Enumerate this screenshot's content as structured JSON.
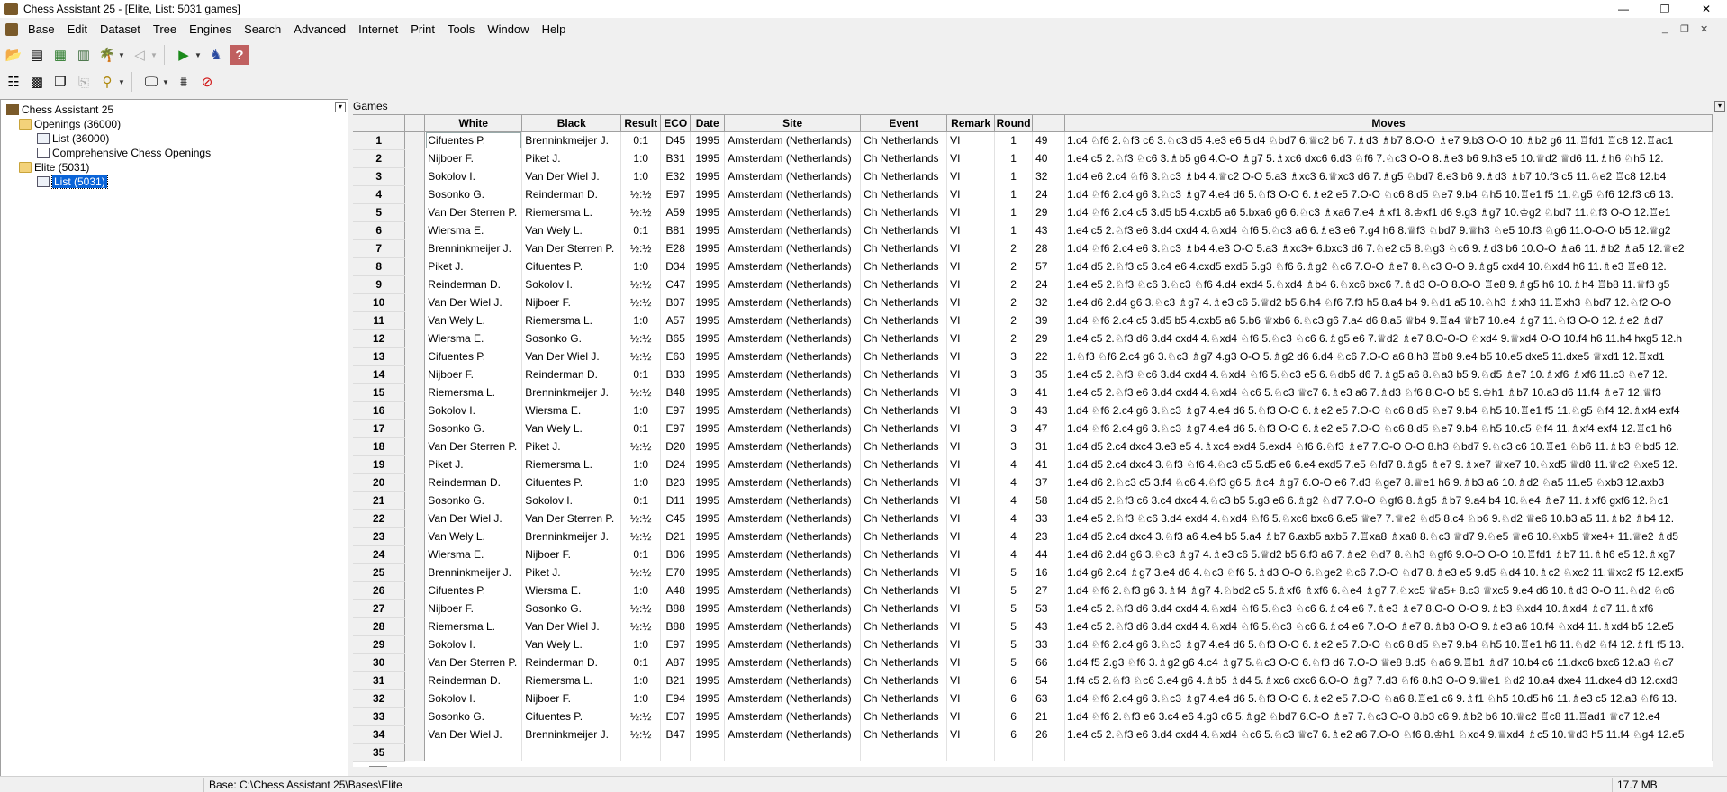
{
  "window": {
    "title": "Chess Assistant 25 - [Elite, List: 5031 games]",
    "controls": {
      "minimize": "—",
      "maximize": "❐",
      "close": "✕"
    },
    "mdi_controls": {
      "minimize": "_",
      "restore": "❐",
      "close": "✕"
    }
  },
  "menu": [
    "Base",
    "Edit",
    "Dataset",
    "Tree",
    "Engines",
    "Search",
    "Advanced",
    "Internet",
    "Print",
    "Tools",
    "Window",
    "Help"
  ],
  "toolbar1": [
    {
      "name": "open-icon",
      "glyph": "📂"
    },
    {
      "name": "list-view-icon",
      "glyph": "▤"
    },
    {
      "name": "database-icon",
      "glyph": "▦"
    },
    {
      "name": "table-icon",
      "glyph": "▥"
    },
    {
      "name": "tree-icon",
      "glyph": "🌴"
    },
    {
      "name": "back-icon",
      "glyph": "◁"
    },
    {
      "name": "play-icon",
      "glyph": "▶"
    },
    {
      "name": "engine-icon",
      "glyph": "♞"
    },
    {
      "name": "help-icon",
      "glyph": "?"
    }
  ],
  "toolbar2": [
    {
      "name": "tree-list-icon",
      "glyph": "☷"
    },
    {
      "name": "board-icon",
      "glyph": "▩"
    },
    {
      "name": "copy-icon",
      "glyph": "❐"
    },
    {
      "name": "paste-icon",
      "glyph": "⎘"
    },
    {
      "name": "find-icon",
      "glyph": "⚲"
    },
    {
      "name": "monitor-icon",
      "glyph": "🖵"
    },
    {
      "name": "filter-icon",
      "glyph": "⩩"
    },
    {
      "name": "stop-icon",
      "glyph": "⊘"
    }
  ],
  "tree": {
    "root": "Chess Assistant 25",
    "openings": "Openings (36000)",
    "openings_list": "List (36000)",
    "comprehensive": "Comprehensive Chess Openings",
    "elite": "Elite (5031)",
    "elite_list": "List (5031)"
  },
  "games_label": "Games",
  "columns": [
    "White",
    "Black",
    "Result",
    "ECO",
    "Date",
    "Site",
    "Event",
    "Remark",
    "Round",
    "",
    "Moves"
  ],
  "rows": [
    [
      "1",
      "Cifuentes P.",
      "Brenninkmeijer J.",
      "0:1",
      "D45",
      "1995",
      "Amsterdam (Netherlands)",
      "Ch Netherlands",
      "VI",
      "1",
      "49",
      "1.c4 ♘f6 2.♘f3 c6 3.♘c3 d5 4.e3 e6 5.d4 ♘bd7 6.♕c2 b6 7.♗d3 ♗b7 8.O-O ♗e7 9.b3 O-O 10.♗b2 g6 11.♖fd1 ♖c8 12.♖ac1"
    ],
    [
      "2",
      "Nijboer F.",
      "Piket J.",
      "1:0",
      "B31",
      "1995",
      "Amsterdam (Netherlands)",
      "Ch Netherlands",
      "VI",
      "1",
      "40",
      "1.e4 c5 2.♘f3 ♘c6 3.♗b5 g6 4.O-O ♗g7 5.♗xc6 dxc6 6.d3 ♘f6 7.♘c3 O-O 8.♗e3 b6 9.h3 e5 10.♕d2 ♕d6 11.♗h6 ♘h5 12."
    ],
    [
      "3",
      "Sokolov I.",
      "Van Der Wiel J.",
      "1:0",
      "E32",
      "1995",
      "Amsterdam (Netherlands)",
      "Ch Netherlands",
      "VI",
      "1",
      "32",
      "1.d4 e6 2.c4 ♘f6 3.♘c3 ♗b4 4.♕c2 O-O 5.a3 ♗xc3 6.♕xc3 d6 7.♗g5 ♘bd7 8.e3 b6 9.♗d3 ♗b7 10.f3 c5 11.♘e2 ♖c8 12.b4"
    ],
    [
      "4",
      "Sosonko G.",
      "Reinderman D.",
      "½:½",
      "E97",
      "1995",
      "Amsterdam (Netherlands)",
      "Ch Netherlands",
      "VI",
      "1",
      "24",
      "1.d4 ♘f6 2.c4 g6 3.♘c3 ♗g7 4.e4 d6 5.♘f3 O-O 6.♗e2 e5 7.O-O ♘c6 8.d5 ♘e7 9.b4 ♘h5 10.♖e1 f5 11.♘g5 ♘f6 12.f3 c6 13."
    ],
    [
      "5",
      "Van Der Sterren P.",
      "Riemersma L.",
      "½:½",
      "A59",
      "1995",
      "Amsterdam (Netherlands)",
      "Ch Netherlands",
      "VI",
      "1",
      "29",
      "1.d4 ♘f6 2.c4 c5 3.d5 b5 4.cxb5 a6 5.bxa6 g6 6.♘c3 ♗xa6 7.e4 ♗xf1 8.♔xf1 d6 9.g3 ♗g7 10.♔g2 ♘bd7 11.♘f3 O-O 12.♖e1"
    ],
    [
      "6",
      "Wiersma E.",
      "Van Wely L.",
      "0:1",
      "B81",
      "1995",
      "Amsterdam (Netherlands)",
      "Ch Netherlands",
      "VI",
      "1",
      "43",
      "1.e4 c5 2.♘f3 e6 3.d4 cxd4 4.♘xd4 ♘f6 5.♘c3 a6 6.♗e3 e6 7.g4 h6 8.♕f3 ♘bd7 9.♕h3 ♘e5 10.f3 ♘g6 11.O-O-O b5 12.♕g2"
    ],
    [
      "7",
      "Brenninkmeijer J.",
      "Van Der Sterren P.",
      "½:½",
      "E28",
      "1995",
      "Amsterdam (Netherlands)",
      "Ch Netherlands",
      "VI",
      "2",
      "28",
      "1.d4 ♘f6 2.c4 e6 3.♘c3 ♗b4 4.e3 O-O 5.a3 ♗xc3+ 6.bxc3 d6 7.♘e2 c5 8.♘g3 ♘c6 9.♗d3 b6 10.O-O ♗a6 11.♗b2 ♗a5 12.♕e2"
    ],
    [
      "8",
      "Piket J.",
      "Cifuentes P.",
      "1:0",
      "D34",
      "1995",
      "Amsterdam (Netherlands)",
      "Ch Netherlands",
      "VI",
      "2",
      "57",
      "1.d4 d5 2.♘f3 c5 3.c4 e6 4.cxd5 exd5 5.g3 ♘f6 6.♗g2 ♘c6 7.O-O ♗e7 8.♘c3 O-O 9.♗g5 cxd4 10.♘xd4 h6 11.♗e3 ♖e8 12."
    ],
    [
      "9",
      "Reinderman D.",
      "Sokolov I.",
      "½:½",
      "C47",
      "1995",
      "Amsterdam (Netherlands)",
      "Ch Netherlands",
      "VI",
      "2",
      "24",
      "1.e4 e5 2.♘f3 ♘c6 3.♘c3 ♘f6 4.d4 exd4 5.♘xd4 ♗b4 6.♘xc6 bxc6 7.♗d3 O-O 8.O-O ♖e8 9.♗g5 h6 10.♗h4 ♖b8 11.♕f3 g5"
    ],
    [
      "10",
      "Van Der Wiel J.",
      "Nijboer F.",
      "½:½",
      "B07",
      "1995",
      "Amsterdam (Netherlands)",
      "Ch Netherlands",
      "VI",
      "2",
      "32",
      "1.e4 d6 2.d4 g6 3.♘c3 ♗g7 4.♗e3 c6 5.♕d2 b5 6.h4 ♘f6 7.f3 h5 8.a4 b4 9.♘d1 a5 10.♘h3 ♗xh3 11.♖xh3 ♘bd7 12.♘f2 O-O"
    ],
    [
      "11",
      "Van Wely L.",
      "Riemersma L.",
      "1:0",
      "A57",
      "1995",
      "Amsterdam (Netherlands)",
      "Ch Netherlands",
      "VI",
      "2",
      "39",
      "1.d4 ♘f6 2.c4 c5 3.d5 b5 4.cxb5 a6 5.b6 ♕xb6 6.♘c3 g6 7.a4 d6 8.a5 ♕b4 9.♖a4 ♕b7 10.e4 ♗g7 11.♘f3 O-O 12.♗e2 ♗d7"
    ],
    [
      "12",
      "Wiersma E.",
      "Sosonko G.",
      "½:½",
      "B65",
      "1995",
      "Amsterdam (Netherlands)",
      "Ch Netherlands",
      "VI",
      "2",
      "29",
      "1.e4 c5 2.♘f3 d6 3.d4 cxd4 4.♘xd4 ♘f6 5.♘c3 ♘c6 6.♗g5 e6 7.♕d2 ♗e7 8.O-O-O ♘xd4 9.♕xd4 O-O 10.f4 h6 11.h4 hxg5 12.h"
    ],
    [
      "13",
      "Cifuentes P.",
      "Van Der Wiel J.",
      "½:½",
      "E63",
      "1995",
      "Amsterdam (Netherlands)",
      "Ch Netherlands",
      "VI",
      "3",
      "22",
      "1.♘f3 ♘f6 2.c4 g6 3.♘c3 ♗g7 4.g3 O-O 5.♗g2 d6 6.d4 ♘c6 7.O-O a6 8.h3 ♖b8 9.e4 b5 10.e5 dxe5 11.dxe5 ♕xd1 12.♖xd1"
    ],
    [
      "14",
      "Nijboer F.",
      "Reinderman D.",
      "0:1",
      "B33",
      "1995",
      "Amsterdam (Netherlands)",
      "Ch Netherlands",
      "VI",
      "3",
      "35",
      "1.e4 c5 2.♘f3 ♘c6 3.d4 cxd4 4.♘xd4 ♘f6 5.♘c3 e5 6.♘db5 d6 7.♗g5 a6 8.♘a3 b5 9.♘d5 ♗e7 10.♗xf6 ♗xf6 11.c3 ♘e7 12."
    ],
    [
      "15",
      "Riemersma L.",
      "Brenninkmeijer J.",
      "½:½",
      "B48",
      "1995",
      "Amsterdam (Netherlands)",
      "Ch Netherlands",
      "VI",
      "3",
      "41",
      "1.e4 c5 2.♘f3 e6 3.d4 cxd4 4.♘xd4 ♘c6 5.♘c3 ♕c7 6.♗e3 a6 7.♗d3 ♘f6 8.O-O b5 9.♔h1 ♗b7 10.a3 d6 11.f4 ♗e7 12.♕f3"
    ],
    [
      "16",
      "Sokolov I.",
      "Wiersma E.",
      "1:0",
      "E97",
      "1995",
      "Amsterdam (Netherlands)",
      "Ch Netherlands",
      "VI",
      "3",
      "43",
      "1.d4 ♘f6 2.c4 g6 3.♘c3 ♗g7 4.e4 d6 5.♘f3 O-O 6.♗e2 e5 7.O-O ♘c6 8.d5 ♘e7 9.b4 ♘h5 10.♖e1 f5 11.♘g5 ♘f4 12.♗xf4 exf4"
    ],
    [
      "17",
      "Sosonko G.",
      "Van Wely L.",
      "0:1",
      "E97",
      "1995",
      "Amsterdam (Netherlands)",
      "Ch Netherlands",
      "VI",
      "3",
      "47",
      "1.d4 ♘f6 2.c4 g6 3.♘c3 ♗g7 4.e4 d6 5.♘f3 O-O 6.♗e2 e5 7.O-O ♘c6 8.d5 ♘e7 9.b4 ♘h5 10.c5 ♘f4 11.♗xf4 exf4 12.♖c1 h6"
    ],
    [
      "18",
      "Van Der Sterren P.",
      "Piket J.",
      "½:½",
      "D20",
      "1995",
      "Amsterdam (Netherlands)",
      "Ch Netherlands",
      "VI",
      "3",
      "31",
      "1.d4 d5 2.c4 dxc4 3.e3 e5 4.♗xc4 exd4 5.exd4 ♘f6 6.♘f3 ♗e7 7.O-O O-O 8.h3 ♘bd7 9.♘c3 c6 10.♖e1 ♘b6 11.♗b3 ♘bd5 12."
    ],
    [
      "19",
      "Piket J.",
      "Riemersma L.",
      "1:0",
      "D24",
      "1995",
      "Amsterdam (Netherlands)",
      "Ch Netherlands",
      "VI",
      "4",
      "41",
      "1.d4 d5 2.c4 dxc4 3.♘f3 ♘f6 4.♘c3 c5 5.d5 e6 6.e4 exd5 7.e5 ♘fd7 8.♗g5 ♗e7 9.♗xe7 ♕xe7 10.♘xd5 ♕d8 11.♕c2 ♘xe5 12."
    ],
    [
      "20",
      "Reinderman D.",
      "Cifuentes P.",
      "1:0",
      "B23",
      "1995",
      "Amsterdam (Netherlands)",
      "Ch Netherlands",
      "VI",
      "4",
      "37",
      "1.e4 d6 2.♘c3 c5 3.f4 ♘c6 4.♘f3 g6 5.♗c4 ♗g7 6.O-O e6 7.d3 ♘ge7 8.♕e1 h6 9.♗b3 a6 10.♗d2 ♘a5 11.e5 ♘xb3 12.axb3"
    ],
    [
      "21",
      "Sosonko G.",
      "Sokolov I.",
      "0:1",
      "D11",
      "1995",
      "Amsterdam (Netherlands)",
      "Ch Netherlands",
      "VI",
      "4",
      "58",
      "1.d4 d5 2.♘f3 c6 3.c4 dxc4 4.♘c3 b5 5.g3 e6 6.♗g2 ♘d7 7.O-O ♘gf6 8.♗g5 ♗b7 9.a4 b4 10.♘e4 ♗e7 11.♗xf6 gxf6 12.♘c1"
    ],
    [
      "22",
      "Van Der Wiel J.",
      "Van Der Sterren P.",
      "½:½",
      "C45",
      "1995",
      "Amsterdam (Netherlands)",
      "Ch Netherlands",
      "VI",
      "4",
      "33",
      "1.e4 e5 2.♘f3 ♘c6 3.d4 exd4 4.♘xd4 ♘f6 5.♘xc6 bxc6 6.e5 ♕e7 7.♕e2 ♘d5 8.c4 ♘b6 9.♘d2 ♕e6 10.b3 a5 11.♗b2 ♗b4 12."
    ],
    [
      "23",
      "Van Wely L.",
      "Brenninkmeijer J.",
      "½:½",
      "D21",
      "1995",
      "Amsterdam (Netherlands)",
      "Ch Netherlands",
      "VI",
      "4",
      "23",
      "1.d4 d5 2.c4 dxc4 3.♘f3 a6 4.e4 b5 5.a4 ♗b7 6.axb5 axb5 7.♖xa8 ♗xa8 8.♘c3 ♕d7 9.♘e5 ♕e6 10.♘xb5 ♕xe4+ 11.♕e2 ♗d5"
    ],
    [
      "24",
      "Wiersma E.",
      "Nijboer F.",
      "0:1",
      "B06",
      "1995",
      "Amsterdam (Netherlands)",
      "Ch Netherlands",
      "VI",
      "4",
      "44",
      "1.e4 d6 2.d4 g6 3.♘c3 ♗g7 4.♗e3 c6 5.♕d2 b5 6.f3 a6 7.♗e2 ♘d7 8.♘h3 ♘gf6 9.O-O O-O 10.♖fd1 ♗b7 11.♗h6 e5 12.♗xg7"
    ],
    [
      "25",
      "Brenninkmeijer J.",
      "Piket J.",
      "½:½",
      "E70",
      "1995",
      "Amsterdam (Netherlands)",
      "Ch Netherlands",
      "VI",
      "5",
      "16",
      "1.d4 g6 2.c4 ♗g7 3.e4 d6 4.♘c3 ♘f6 5.♗d3 O-O 6.♘ge2 ♘c6 7.O-O ♘d7 8.♗e3 e5 9.d5 ♘d4 10.♗c2 ♘xc2 11.♕xc2 f5 12.exf5"
    ],
    [
      "26",
      "Cifuentes P.",
      "Wiersma E.",
      "1:0",
      "A48",
      "1995",
      "Amsterdam (Netherlands)",
      "Ch Netherlands",
      "VI",
      "5",
      "27",
      "1.d4 ♘f6 2.♘f3 g6 3.♗f4 ♗g7 4.♘bd2 c5 5.♗xf6 ♗xf6 6.♘e4 ♗g7 7.♘xc5 ♕a5+ 8.c3 ♕xc5 9.e4 d6 10.♗d3 O-O 11.♘d2 ♘c6"
    ],
    [
      "27",
      "Nijboer F.",
      "Sosonko G.",
      "½:½",
      "B88",
      "1995",
      "Amsterdam (Netherlands)",
      "Ch Netherlands",
      "VI",
      "5",
      "53",
      "1.e4 c5 2.♘f3 d6 3.d4 cxd4 4.♘xd4 ♘f6 5.♘c3 ♘c6 6.♗c4 e6 7.♗e3 ♗e7 8.O-O O-O 9.♗b3 ♘xd4 10.♗xd4 ♗d7 11.♗xf6"
    ],
    [
      "28",
      "Riemersma L.",
      "Van Der Wiel J.",
      "½:½",
      "B88",
      "1995",
      "Amsterdam (Netherlands)",
      "Ch Netherlands",
      "VI",
      "5",
      "43",
      "1.e4 c5 2.♘f3 d6 3.d4 cxd4 4.♘xd4 ♘f6 5.♘c3 ♘c6 6.♗c4 e6 7.O-O ♗e7 8.♗b3 O-O 9.♗e3 a6 10.f4 ♘xd4 11.♗xd4 b5 12.e5"
    ],
    [
      "29",
      "Sokolov I.",
      "Van Wely L.",
      "1:0",
      "E97",
      "1995",
      "Amsterdam (Netherlands)",
      "Ch Netherlands",
      "VI",
      "5",
      "33",
      "1.d4 ♘f6 2.c4 g6 3.♘c3 ♗g7 4.e4 d6 5.♘f3 O-O 6.♗e2 e5 7.O-O ♘c6 8.d5 ♘e7 9.b4 ♘h5 10.♖e1 h6 11.♘d2 ♘f4 12.♗f1 f5 13."
    ],
    [
      "30",
      "Van Der Sterren P.",
      "Reinderman D.",
      "0:1",
      "A87",
      "1995",
      "Amsterdam (Netherlands)",
      "Ch Netherlands",
      "VI",
      "5",
      "66",
      "1.d4 f5 2.g3 ♘f6 3.♗g2 g6 4.c4 ♗g7 5.♘c3 O-O 6.♘f3 d6 7.O-O ♕e8 8.d5 ♘a6 9.♖b1 ♗d7 10.b4 c6 11.dxc6 bxc6 12.a3 ♘c7"
    ],
    [
      "31",
      "Reinderman D.",
      "Riemersma L.",
      "1:0",
      "B21",
      "1995",
      "Amsterdam (Netherlands)",
      "Ch Netherlands",
      "VI",
      "6",
      "54",
      "1.f4 c5 2.♘f3 ♘c6 3.e4 g6 4.♗b5 ♗d4 5.♗xc6 dxc6 6.O-O ♗g7 7.d3 ♘f6 8.h3 O-O 9.♕e1 ♘d2 10.a4 dxe4 11.dxe4 d3 12.cxd3"
    ],
    [
      "32",
      "Sokolov I.",
      "Nijboer F.",
      "1:0",
      "E94",
      "1995",
      "Amsterdam (Netherlands)",
      "Ch Netherlands",
      "VI",
      "6",
      "63",
      "1.d4 ♘f6 2.c4 g6 3.♘c3 ♗g7 4.e4 d6 5.♘f3 O-O 6.♗e2 e5 7.O-O ♘a6 8.♖e1 c6 9.♗f1 ♘h5 10.d5 h6 11.♗e3 c5 12.a3 ♘f6 13."
    ],
    [
      "33",
      "Sosonko G.",
      "Cifuentes P.",
      "½:½",
      "E07",
      "1995",
      "Amsterdam (Netherlands)",
      "Ch Netherlands",
      "VI",
      "6",
      "21",
      "1.d4 ♘f6 2.♘f3 e6 3.c4 e6 4.g3 c6 5.♗g2 ♘bd7 6.O-O ♗e7 7.♘c3 O-O 8.b3 c6 9.♗b2 b6 10.♕c2 ♖c8 11.♖ad1 ♕c7 12.e4"
    ],
    [
      "34",
      "Van Der Wiel J.",
      "Brenninkmeijer J.",
      "½:½",
      "B47",
      "1995",
      "Amsterdam (Netherlands)",
      "Ch Netherlands",
      "VI",
      "6",
      "26",
      "1.e4 c5 2.♘f3 e6 3.d4 cxd4 4.♘xd4 ♘c6 5.♘c3 ♕c7 6.♗e2 a6 7.O-O ♘f6 8.♔h1 ♘xd4 9.♕xd4 ♗c5 10.♕d3 h5 11.f4 ♘g4 12.e5"
    ],
    [
      "35",
      "",
      "",
      "",
      "",
      "",
      "",
      "",
      "",
      "",
      "",
      ""
    ]
  ],
  "status": {
    "path": "Base: C:\\Chess Assistant 25\\Bases\\Elite",
    "memory": "17.7 MB"
  }
}
